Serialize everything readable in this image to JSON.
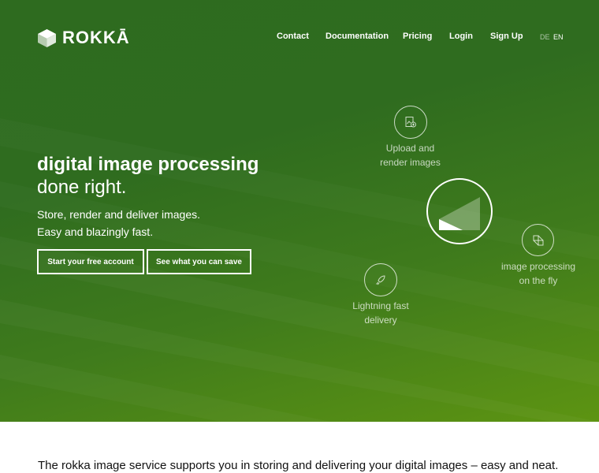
{
  "brand": {
    "name": "ROKKĀ"
  },
  "nav": {
    "items": [
      "Contact",
      "Documentation",
      "Pricing",
      "Login",
      "Sign Up"
    ],
    "languages": [
      "DE",
      "EN"
    ],
    "active_language": "EN"
  },
  "hero": {
    "title_bold": "digital image processing",
    "title_regular": "done right.",
    "subtitle_line1": "Store, render and deliver images.",
    "subtitle_line2": "Easy and blazingly fast.",
    "cta_primary": "Start your free account",
    "cta_secondary": "See what you can save"
  },
  "features": {
    "upload": {
      "line1": "Upload and",
      "line2": "render images",
      "icon": "image-upload-icon"
    },
    "processing": {
      "line1": "image processing",
      "line2": "on the fly",
      "icon": "image-processing-icon"
    },
    "delivery": {
      "line1": "Lightning fast",
      "line2": "delivery",
      "icon": "rocket-icon"
    }
  },
  "tagline": "The rokka image service supports you in storing and delivering your digital images – easy and neat.",
  "colors": {
    "hero_top": "#2e6b1f",
    "hero_bottom": "#5d9412",
    "text_on_hero": "#ffffff"
  }
}
